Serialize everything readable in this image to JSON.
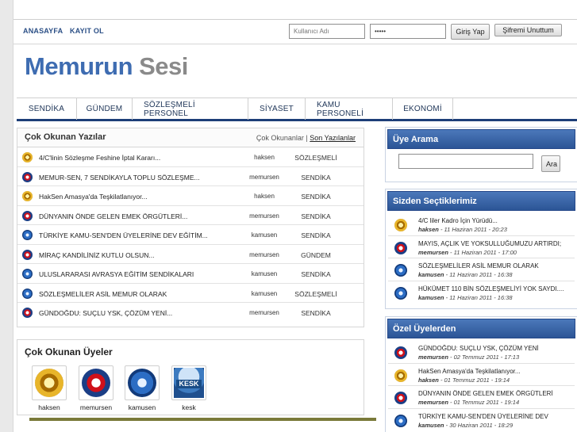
{
  "header": {
    "links": [
      {
        "label": "ANASAYFA"
      },
      {
        "label": "KAYIT OL"
      }
    ],
    "username_placeholder": "Kullanıcı Adı",
    "password_value": "•••••",
    "login_button": "Giriş Yap",
    "forgot_button": "Şifremi Unuttum"
  },
  "logo": {
    "part1": "Memurun",
    "part2": "Sesi"
  },
  "nav": {
    "items": [
      {
        "label": "SENDİKA"
      },
      {
        "label": "GÜNDEM"
      },
      {
        "label": "SÖZLEŞMELİ PERSONEL"
      },
      {
        "label": "SİYASET"
      },
      {
        "label": "KAMU PERSONELİ"
      },
      {
        "label": "EKONOMİ"
      }
    ]
  },
  "popular": {
    "title": "Çok Okunan Yazılar",
    "tab_active": "Çok Okunanlar",
    "separator": "|",
    "tab_other": "Son Yazılanlar",
    "rows": [
      {
        "title": "4/C'linin Sözleşme Feshine İptal Kararı...",
        "user": "haksen",
        "category": "SÖZLEŞMELİ",
        "icon": "haksen-logo-icon"
      },
      {
        "title": "MEMUR-SEN, 7 SENDİKAYLA TOPLU SÖZLEŞME...",
        "user": "memursen",
        "category": "SENDİKA",
        "icon": "memursen-logo-icon"
      },
      {
        "title": "HakSen Amasya'da Teşkilatlanıyor...",
        "user": "haksen",
        "category": "SENDİKA",
        "icon": "haksen-logo-icon"
      },
      {
        "title": "DÜNYANIN ÖNDE GELEN EMEK ÖRGÜTLERİ...",
        "user": "memursen",
        "category": "SENDİKA",
        "icon": "memursen-logo-icon"
      },
      {
        "title": "TÜRKİYE KAMU-SEN'DEN ÜYELERİNE DEV EĞİTİM...",
        "user": "kamusen",
        "category": "SENDİKA",
        "icon": "kamusen-logo-icon"
      },
      {
        "title": "MİRAÇ KANDİLİNİZ KUTLU OLSUN...",
        "user": "memursen",
        "category": "GÜNDEM",
        "icon": "memursen-logo-icon"
      },
      {
        "title": "ULUSLARARASI AVRASYA EĞİTİM SENDİKALARI",
        "user": "kamusen",
        "category": "SENDİKA",
        "icon": "kamusen-logo-icon"
      },
      {
        "title": "SÖZLEŞMELİLER ASİL MEMUR OLARAK",
        "user": "kamusen",
        "category": "SÖZLEŞMELİ",
        "icon": "kamusen-logo-icon"
      },
      {
        "title": "GÜNDOĞDU: SUÇLU YSK, ÇÖZÜM YENİ...",
        "user": "memursen",
        "category": "SENDİKA",
        "icon": "memursen-logo-icon"
      }
    ]
  },
  "members": {
    "title": "Çok Okunan Üyeler",
    "items": [
      {
        "name": "haksen",
        "icon": "haksen-logo-icon"
      },
      {
        "name": "memursen",
        "icon": "memursen-logo-icon"
      },
      {
        "name": "kamusen",
        "icon": "kamusen-logo-icon"
      },
      {
        "name": "kesk",
        "icon": "kesk-logo-icon",
        "badge": "KESK"
      }
    ]
  },
  "member_search": {
    "title": "Üye Arama",
    "button": "Ara",
    "value": ""
  },
  "picks": {
    "title": "Sizden Seçtiklerimiz",
    "items": [
      {
        "title": "4/C liler Kadro İçin Yürüdü...",
        "user": "haksen",
        "date": " - 11 Haziran 2011 - 20:23",
        "icon": "haksen-logo-icon"
      },
      {
        "title": "MAYIS, AÇLIK VE YOKSULLUĞUMUZU ARTIRDI;",
        "user": "memursen",
        "date": " - 11 Haziran 2011 - 17:00",
        "icon": "memursen-logo-icon"
      },
      {
        "title": "SÖZLEŞMELİLER ASİL MEMUR OLARAK",
        "user": "kamusen",
        "date": " - 11 Haziran 2011 - 16:38",
        "icon": "kamusen-logo-icon"
      },
      {
        "title": "HÜKÜMET 110 BİN SÖZLEŞMELİYİ YOK SAYDI....",
        "user": "kamusen",
        "date": " - 11 Haziran 2011 - 16:38",
        "icon": "kamusen-logo-icon"
      }
    ]
  },
  "special": {
    "title": "Özel Üyelerden",
    "items": [
      {
        "title": "GÜNDOĞDU: SUÇLU YSK, ÇÖZÜM YENİ",
        "user": "memursen",
        "date": " - 02 Temmuz 2011 - 17:13",
        "icon": "memursen-logo-icon"
      },
      {
        "title": "HakSen Amasya'da Teşkilatlanıyor...",
        "user": "haksen",
        "date": " - 01 Temmuz 2011 - 19:14",
        "icon": "haksen-logo-icon"
      },
      {
        "title": "DÜNYANIN ÖNDE GELEN EMEK ÖRGÜTLERİ",
        "user": "memursen",
        "date": " - 01 Temmuz 2011 - 19:14",
        "icon": "memursen-logo-icon"
      },
      {
        "title": "TÜRKİYE KAMU-SEN'DEN ÜYELERİNE DEV",
        "user": "kamusen",
        "date": " - 30 Haziran 2011 - 18:29",
        "icon": "kamusen-logo-icon"
      }
    ]
  }
}
